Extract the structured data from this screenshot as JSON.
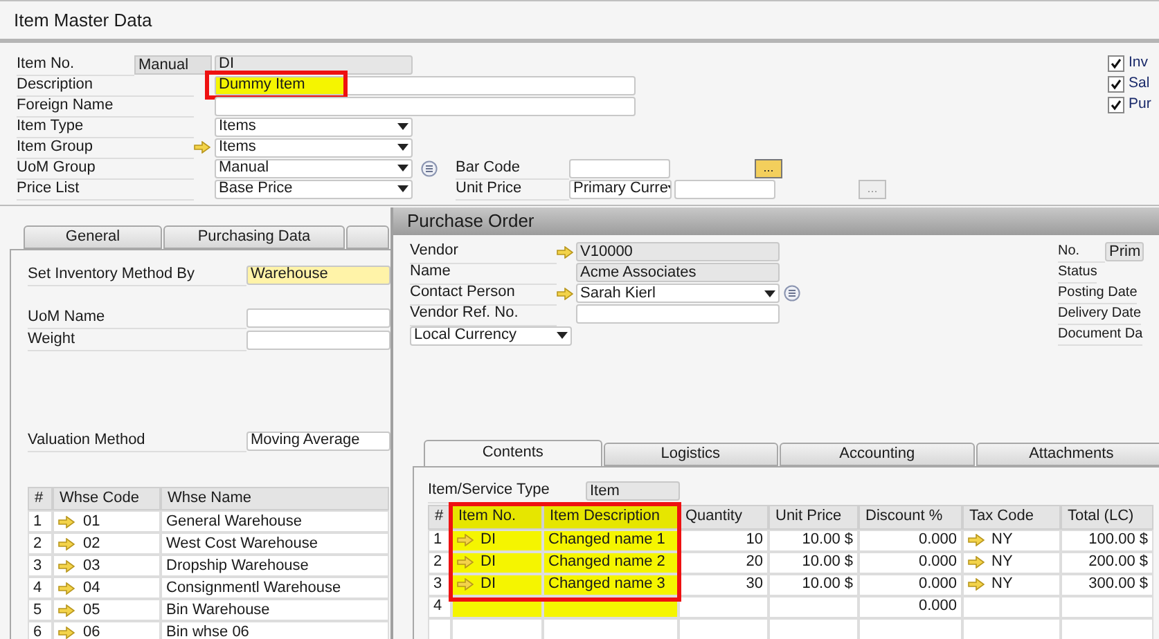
{
  "item_master": {
    "title": "Item Master Data",
    "header_fields": [
      {
        "label": "Item No.",
        "kind": "series",
        "series": "Manual",
        "value": "DI"
      },
      {
        "label": "Description",
        "kind": "text",
        "value": "Dummy Item",
        "highlighted": true
      },
      {
        "label": "Foreign Name",
        "kind": "text",
        "highlighted": false
      },
      {
        "label": "Item Type",
        "kind": "dropdown",
        "value": "Items",
        "link": false
      },
      {
        "label": "Item Group",
        "kind": "dropdown",
        "value": "Items",
        "link": true
      },
      {
        "label": "UoM Group",
        "kind": "dropdown",
        "value": "Manual",
        "link": false
      },
      {
        "label": "Price List",
        "kind": "dropdown",
        "value": "Base Price",
        "link": false
      }
    ],
    "bar_code": {
      "label": "Bar Code",
      "button": "...",
      "disabled": false
    },
    "unit_price": {
      "label": "Unit Price",
      "currency": "Primary Curre",
      "button": "...",
      "disabled": true
    },
    "checkboxes": [
      {
        "label": "Inv",
        "checked": true
      },
      {
        "label": "Sal",
        "checked": true
      },
      {
        "label": "Pur",
        "checked": true
      }
    ],
    "tabs": [
      {
        "label": "General",
        "selected": false
      },
      {
        "label": "Purchasing Data",
        "selected": false
      }
    ],
    "inventory_fields": [
      {
        "label": "Set Inventory Method By",
        "value": "Warehouse",
        "highlighted": true
      },
      {
        "label": "UoM Name",
        "highlighted": false
      },
      {
        "label": "Weight",
        "highlighted": false
      },
      {
        "label": "Valuation Method",
        "value": "Moving Average",
        "highlighted": false
      }
    ],
    "warehouse_table": {
      "columns": [
        "#",
        "Whse Code",
        "Whse Name"
      ],
      "rows": [
        [
          "1",
          "01",
          "General Warehouse"
        ],
        [
          "2",
          "02",
          "West Cost Warehouse"
        ],
        [
          "3",
          "03",
          "Dropship Warehouse"
        ],
        [
          "4",
          "04",
          "Consignmentl Warehouse"
        ],
        [
          "5",
          "05",
          "Bin Warehouse"
        ],
        [
          "6",
          "06",
          "Bin whse 06"
        ]
      ]
    }
  },
  "purchase_order": {
    "title": "Purchase Order",
    "fields": [
      {
        "label": "Vendor",
        "kind": "readonly",
        "value": "V10000",
        "link": true
      },
      {
        "label": "Name",
        "kind": "readonly",
        "value": "Acme Associates",
        "link": false
      },
      {
        "label": "Contact Person",
        "kind": "dropdown",
        "value": "Sarah Kierl",
        "link": true
      },
      {
        "label": "Vendor Ref. No.",
        "kind": "text",
        "link": false
      }
    ],
    "currency": "Local Currency",
    "right_fields": [
      {
        "label": "No.",
        "value": "Prim"
      },
      {
        "label": "Status"
      },
      {
        "label": "Posting Date"
      },
      {
        "label": "Delivery Date"
      },
      {
        "label": "Document Da"
      }
    ],
    "tabs": [
      {
        "label": "Contents",
        "selected": true
      },
      {
        "label": "Logistics",
        "selected": false
      },
      {
        "label": "Accounting",
        "selected": false
      },
      {
        "label": "Attachments",
        "selected": false
      }
    ],
    "item_service_type": {
      "label": "Item/Service Type",
      "value": "Item"
    },
    "lines_table": {
      "columns": [
        {
          "label": "#",
          "highlighted": false
        },
        {
          "label": "Item No.",
          "highlighted": true
        },
        {
          "label": "Item Description",
          "highlighted": true
        },
        {
          "label": "Quantity",
          "highlighted": false
        },
        {
          "label": "Unit Price",
          "highlighted": false
        },
        {
          "label": "Discount %",
          "highlighted": false
        },
        {
          "label": "Tax Code",
          "highlighted": false
        },
        {
          "label": "Total (LC)",
          "highlighted": false
        }
      ],
      "rows": [
        {
          "num": "1",
          "item_no": "DI",
          "description": "Changed name 1",
          "quantity": "10",
          "unit_price": "10.00 $",
          "discount": "0.000",
          "tax_code": "NY",
          "total": "100.00 $"
        },
        {
          "num": "2",
          "item_no": "DI",
          "description": "Changed name 2",
          "quantity": "20",
          "unit_price": "10.00 $",
          "discount": "0.000",
          "tax_code": "NY",
          "total": "200.00 $"
        },
        {
          "num": "3",
          "item_no": "DI",
          "description": "Changed name 3",
          "quantity": "30",
          "unit_price": "10.00 $",
          "discount": "0.000",
          "tax_code": "NY",
          "total": "300.00 $"
        },
        {
          "num": "4",
          "discount": "0.000"
        }
      ]
    }
  }
}
